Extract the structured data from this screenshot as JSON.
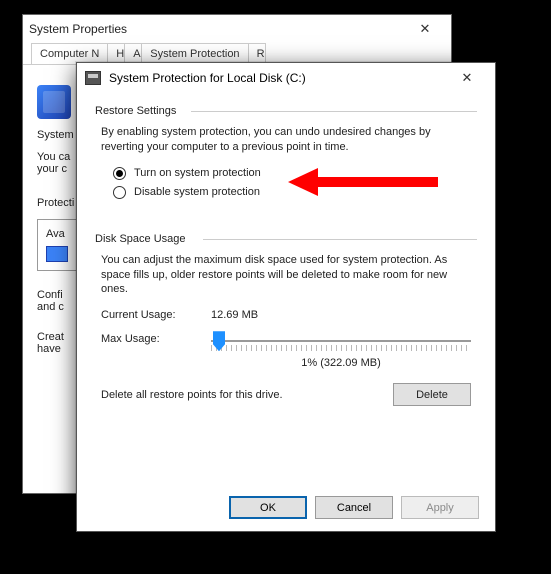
{
  "back": {
    "title": "System Properties",
    "tabs": [
      "Computer N",
      "H",
      "A",
      "System Protection",
      "R"
    ],
    "line1": "System",
    "line2a": "You ca",
    "line2b": "your c",
    "line3": "Protecti",
    "line4": "Ava",
    "line5a": "Confi",
    "line5b": "and c",
    "line6a": "Creat",
    "line6b": "have"
  },
  "front": {
    "title": "System Protection for Local Disk (C:)",
    "restore": {
      "group": "Restore Settings",
      "desc": "By enabling system protection, you can undo undesired changes by reverting your computer to a previous point in time.",
      "opt_on": "Turn on system protection",
      "opt_off": "Disable system protection",
      "selected": "on"
    },
    "disk": {
      "group": "Disk Space Usage",
      "desc": "You can adjust the maximum disk space used for system protection. As space fills up, older restore points will be deleted to make room for new ones.",
      "current_label": "Current Usage:",
      "current_value": "12.69 MB",
      "max_label": "Max Usage:",
      "readout": "1% (322.09 MB)"
    },
    "delete_desc": "Delete all restore points for this drive.",
    "buttons": {
      "delete": "Delete",
      "ok": "OK",
      "cancel": "Cancel",
      "apply": "Apply"
    }
  }
}
